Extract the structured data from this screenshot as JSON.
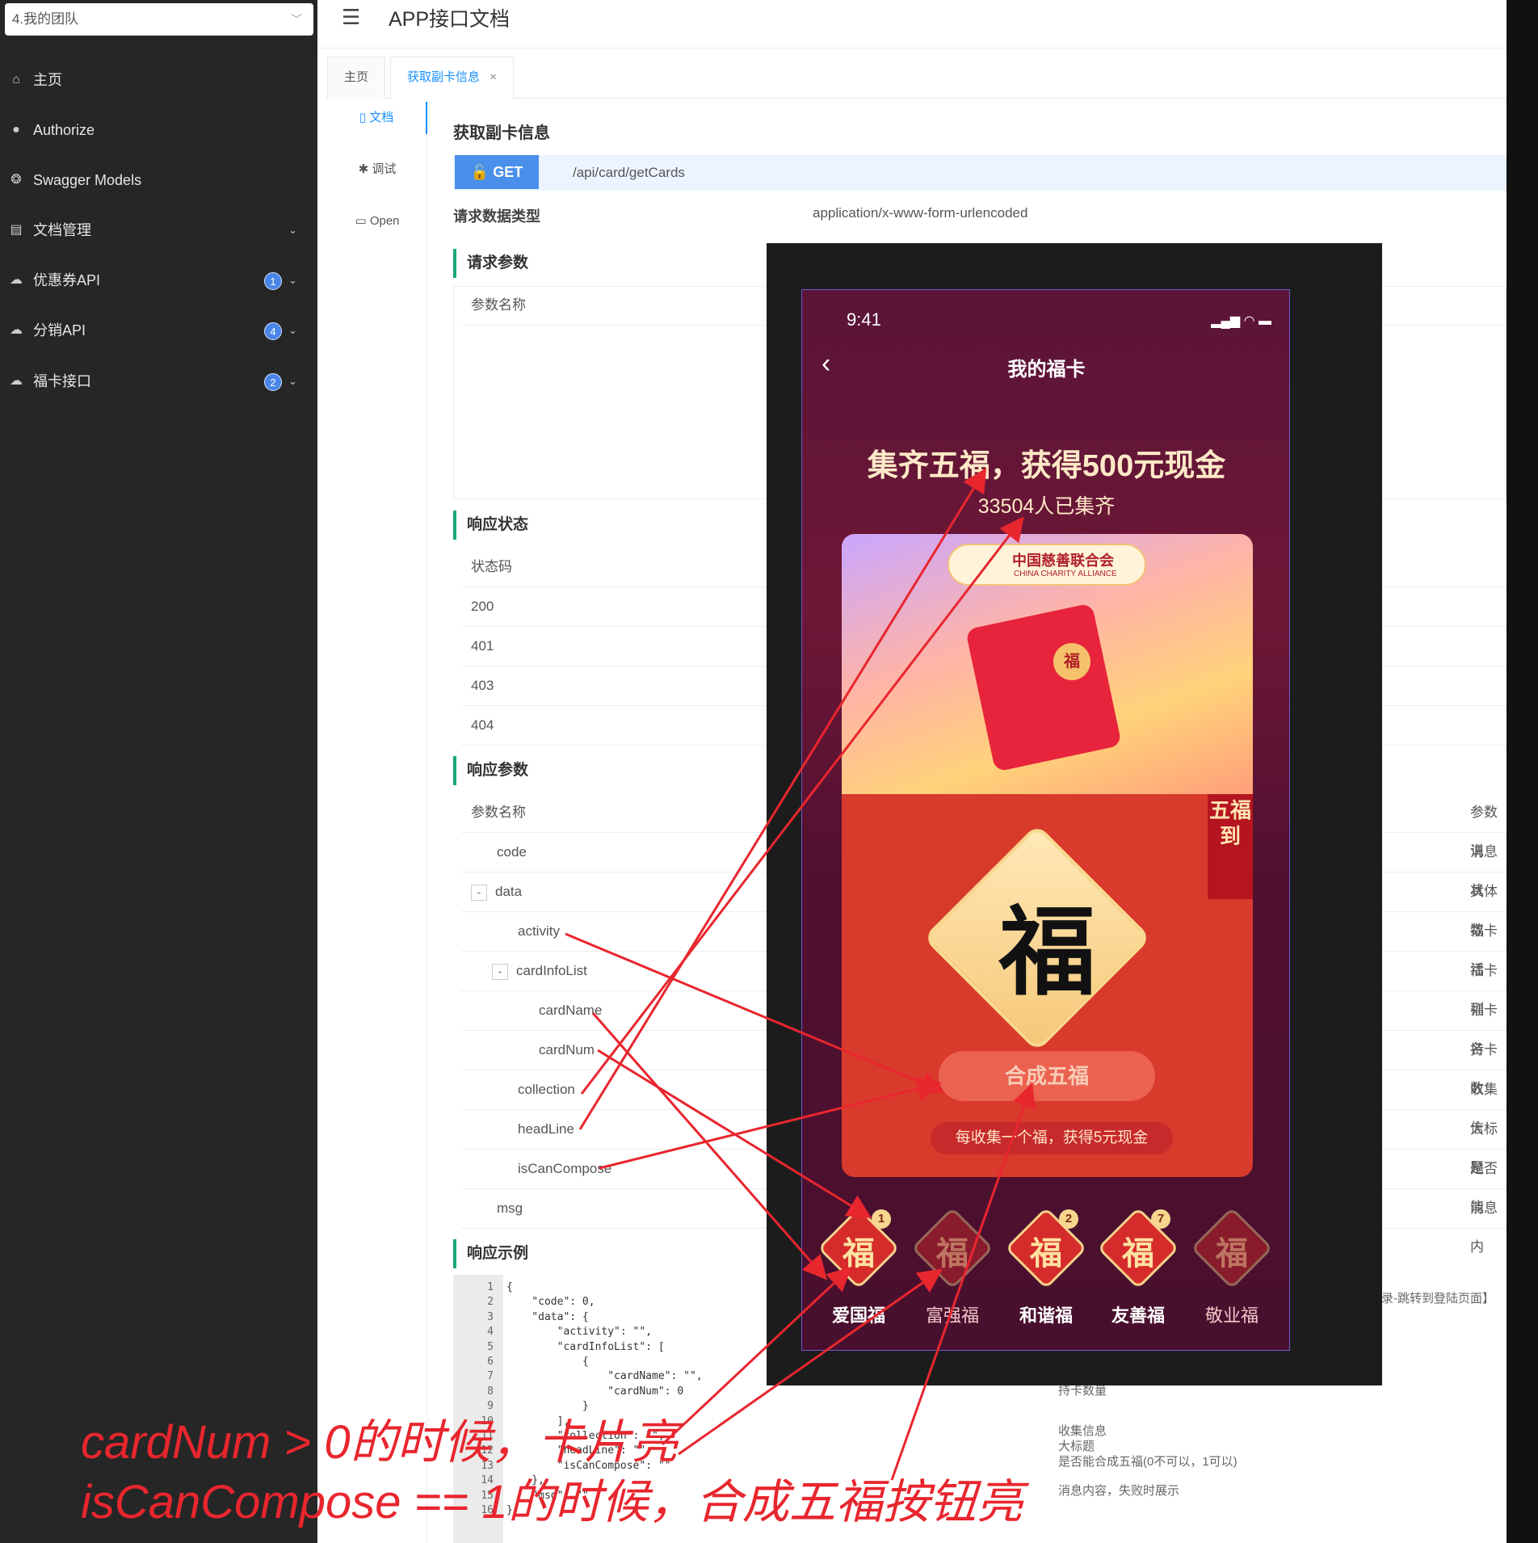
{
  "sidebar": {
    "team": "4.我的团队",
    "items": [
      {
        "icon": "home-icon",
        "label": "主页",
        "badge": ""
      },
      {
        "icon": "lock-icon",
        "label": "Authorize",
        "badge": ""
      },
      {
        "icon": "cube-icon",
        "label": "Swagger Models",
        "badge": ""
      },
      {
        "icon": "doc-icon",
        "label": "文档管理",
        "badge": ""
      },
      {
        "icon": "cloud-icon",
        "label": "优惠券API",
        "badge": "1"
      },
      {
        "icon": "cloud-icon",
        "label": "分销API",
        "badge": "4"
      },
      {
        "icon": "cloud-icon",
        "label": "福卡接口",
        "badge": "2"
      }
    ]
  },
  "header": {
    "title": "APP接口文档"
  },
  "tabs": [
    {
      "label": "主页"
    },
    {
      "label": "获取副卡信息",
      "close": "×"
    }
  ],
  "submenu": [
    {
      "label": "文档",
      "icon": "doc-icon"
    },
    {
      "label": "调试",
      "icon": "bug-icon"
    },
    {
      "label": "Open",
      "icon": "file-icon"
    }
  ],
  "doc": {
    "title": "获取副卡信息",
    "method": "GET",
    "path": "/api/card/getCards",
    "req_type_label": "请求数据类型",
    "req_type_value": "application/x-www-form-urlencoded",
    "req_params_title": "请求参数",
    "req_params_header": "参数名称",
    "status_title": "响应状态",
    "status_header": "状态码",
    "status_codes": [
      "200",
      "401",
      "403",
      "404"
    ],
    "resp_params_title": "响应参数",
    "resp_params_header": "参数名称",
    "resp_desc_header": "参数说",
    "resp_rows": [
      {
        "name": "code",
        "desc": "消息状"
      },
      {
        "name": "data",
        "desc": "具体数",
        "toggle": "-"
      },
      {
        "name": "activity",
        "desc": "福卡活"
      },
      {
        "name": "cardInfoList",
        "desc": "福卡列",
        "toggle": "-"
      },
      {
        "name": "cardName",
        "desc": "福卡名"
      },
      {
        "name": "cardNum",
        "desc": "持卡数"
      },
      {
        "name": "collection",
        "desc": "收集信"
      },
      {
        "name": "headLine",
        "desc": "大标题"
      },
      {
        "name": "isCanCompose",
        "desc": "是否能"
      },
      {
        "name": "msg",
        "desc": "消息内"
      }
    ],
    "example_title": "响应示例",
    "login_note": "录-跳转到登陆页面】",
    "code_lines": [
      "{",
      "    \"code\": 0,",
      "    \"data\": {",
      "        \"activity\": \"\",",
      "        \"cardInfoList\": [",
      "            {",
      "                \"cardName\": \"\",",
      "                \"cardNum\": 0",
      "            }",
      "        ],",
      "        \"collection\": \"\",",
      "        \"headLine\": \"\",",
      "        \"isCanCompose\": \"\"",
      "    },",
      "    \"msg\": \"\"",
      "}"
    ],
    "code_comments": [
      "持卡数量",
      "收集信息",
      "大标题",
      "是否能合成五福(0不可以，1可以)",
      "消息内容，失败时展示"
    ]
  },
  "phone": {
    "time": "9:41",
    "status_icons": "▂▄▆ ◠ ▬",
    "nav_title": "我的福卡",
    "headline": "集齐五福，获得500元现金",
    "collected": "33504人已集齐",
    "org_cn": "中国慈善联合会",
    "org_en": "CHINA CHARITY ALLIANCE",
    "seal": "福",
    "ribbon": "五福到",
    "big_fu": "福",
    "compose_button": "合成五福",
    "tip": "每收集一个福，获得5元现金",
    "cards": [
      {
        "name": "爱国福",
        "glyph": "福",
        "num": "1",
        "state": "on"
      },
      {
        "name": "富强福",
        "glyph": "福",
        "num": "",
        "state": "dim"
      },
      {
        "name": "和谐福",
        "glyph": "福",
        "num": "2",
        "state": "on"
      },
      {
        "name": "友善福",
        "glyph": "福",
        "num": "7",
        "state": "on"
      },
      {
        "name": "敬业福",
        "glyph": "福",
        "num": "",
        "state": "dim"
      }
    ]
  },
  "annotations": {
    "line1": "cardNum > 0的时候，卡片亮",
    "line2": "isCanCompose == 1的时候，合成五福按钮亮",
    "arrow_color": "#e8262e"
  }
}
